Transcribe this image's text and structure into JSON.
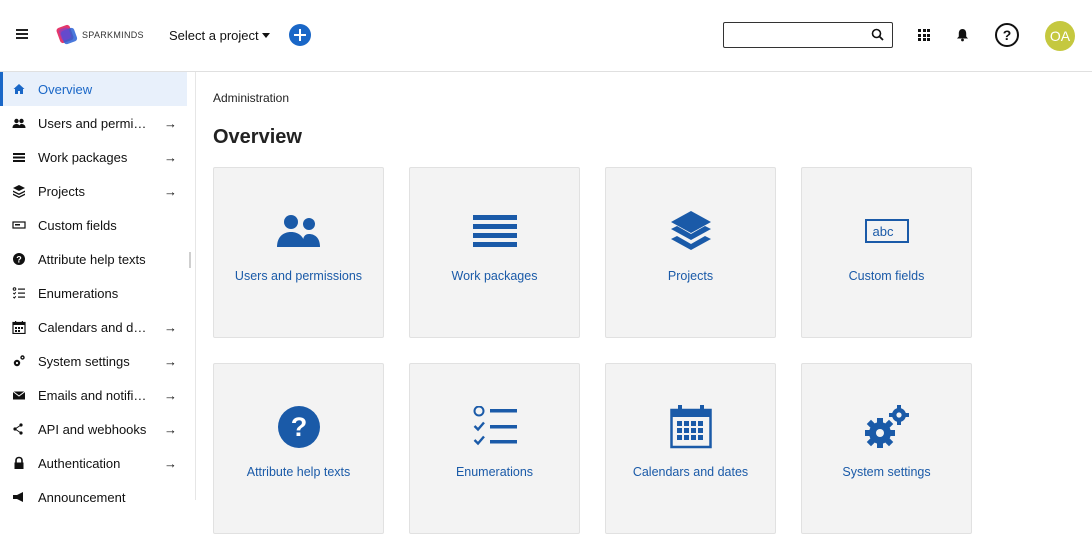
{
  "header": {
    "logo_text": "SPARKMINDS",
    "project_select": "Select a project",
    "search_placeholder": "",
    "avatar_initials": "OA",
    "help_label": "?"
  },
  "sidebar": {
    "items": [
      {
        "label": "Overview",
        "icon": "home-icon",
        "arrow": false,
        "active": true
      },
      {
        "label": "Users and permi…",
        "icon": "users-icon",
        "arrow": true
      },
      {
        "label": "Work packages",
        "icon": "list-icon",
        "arrow": true
      },
      {
        "label": "Projects",
        "icon": "layers-icon",
        "arrow": true
      },
      {
        "label": "Custom fields",
        "icon": "custom-field-icon",
        "arrow": false
      },
      {
        "label": "Attribute help texts",
        "icon": "help-circle-icon",
        "arrow": false
      },
      {
        "label": "Enumerations",
        "icon": "enumerations-icon",
        "arrow": false
      },
      {
        "label": "Calendars and d…",
        "icon": "calendar-icon",
        "arrow": true
      },
      {
        "label": "System settings",
        "icon": "gears-icon",
        "arrow": true
      },
      {
        "label": "Emails and notifi…",
        "icon": "mail-icon",
        "arrow": true
      },
      {
        "label": "API and webhooks",
        "icon": "api-icon",
        "arrow": true
      },
      {
        "label": "Authentication",
        "icon": "lock-icon",
        "arrow": true
      },
      {
        "label": "Announcement",
        "icon": "announcement-icon",
        "arrow": false
      }
    ],
    "arrow_glyph": "→"
  },
  "main": {
    "breadcrumb": "Administration",
    "title": "Overview",
    "tiles": [
      {
        "label": "Users and permissions",
        "icon": "users-icon"
      },
      {
        "label": "Work packages",
        "icon": "list-icon"
      },
      {
        "label": "Projects",
        "icon": "layers-icon"
      },
      {
        "label": "Custom fields",
        "icon": "custom-field-icon",
        "icon_text": "abc"
      },
      {
        "label": "Attribute help texts",
        "icon": "help-circle-icon",
        "icon_text": "?"
      },
      {
        "label": "Enumerations",
        "icon": "enumerations-icon"
      },
      {
        "label": "Calendars and dates",
        "icon": "calendar-icon"
      },
      {
        "label": "System settings",
        "icon": "gears-icon"
      }
    ]
  },
  "colors": {
    "accent": "#1a67c7",
    "tile_label": "#1a5aa8",
    "avatar_bg": "#c5c83f",
    "tile_bg": "#f3f3f3",
    "active_bg": "#e8f0fb"
  }
}
